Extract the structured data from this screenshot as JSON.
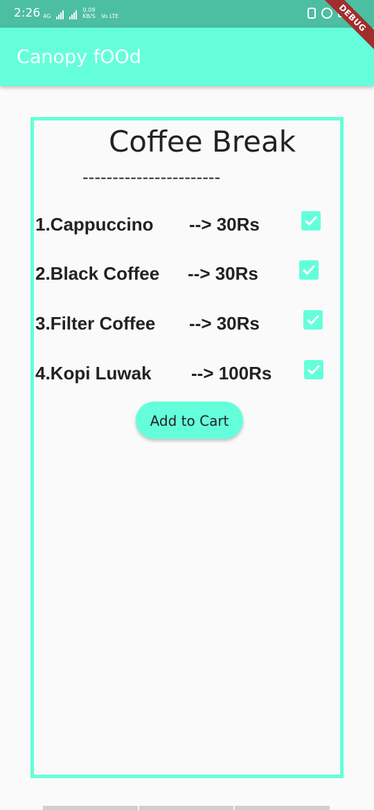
{
  "status_bar": {
    "time": "2:26",
    "network": "4G",
    "speed_value": "0.09",
    "speed_unit": "KB/S",
    "carrier": "Vo LTE"
  },
  "debug_banner": "DEBUG",
  "app_bar": {
    "title": "Canopy fOOd"
  },
  "menu": {
    "title": "Coffee Break",
    "divider": "-----------------------",
    "items": [
      {
        "name": "1.Cappuccino",
        "price": "-->  30Rs",
        "checked": true
      },
      {
        "name": "2.Black Coffee",
        "price": "--> 30Rs",
        "checked": true
      },
      {
        "name": "3.Filter Coffee",
        "price": "--> 30Rs",
        "checked": true
      },
      {
        "name": "4.Kopi Luwak",
        "price": "--> 100Rs",
        "checked": true
      }
    ],
    "add_to_cart_label": "Add to Cart"
  },
  "colors": {
    "accent": "#64ffda",
    "status_bar": "#4cbea1"
  }
}
